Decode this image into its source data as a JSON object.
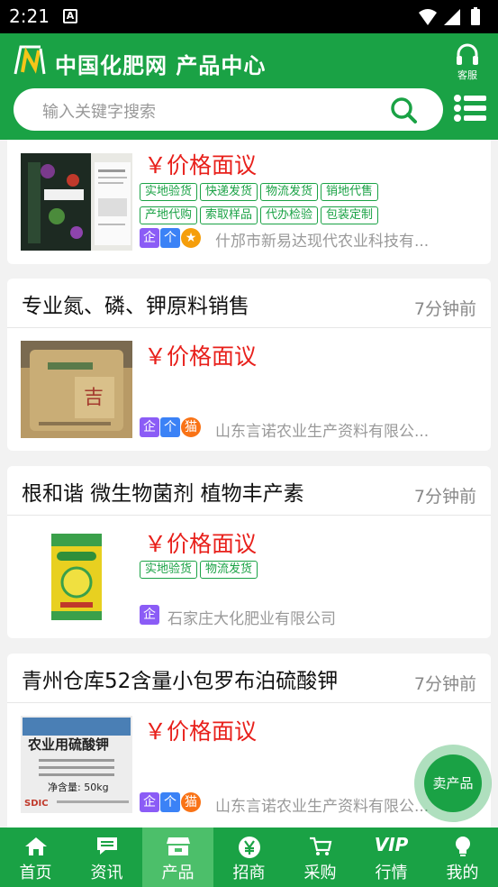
{
  "status_bar": {
    "time": "2:21",
    "notification_letter": "A"
  },
  "header": {
    "logo_letter": "N",
    "title": "中国化肥网 产品中心",
    "service_label": "客服",
    "search_placeholder": "输入关键字搜索"
  },
  "products": [
    {
      "title": "",
      "time": "",
      "price": "￥价格面议",
      "tags": [
        "实地验货",
        "快递发货",
        "物流发货",
        "销地代售",
        "产地代购",
        "索取样品",
        "代办检验",
        "包装定制"
      ],
      "badges": [
        "企",
        "个",
        "★"
      ],
      "company": "什邡市新易达现代农业科技有...",
      "thumb_text": "NUTRITION"
    },
    {
      "title": "专业氮、磷、钾原料销售",
      "time": "7分钟前",
      "price": "￥价格面议",
      "tags": [],
      "badges": [
        "企",
        "个",
        "猫"
      ],
      "company": "山东言诺农业生产资料有限公..."
    },
    {
      "title": "根和谐 微生物菌剂   植物丰产素",
      "time": "7分钟前",
      "price": "￥价格面议",
      "tags": [
        "实地验货",
        "物流发货"
      ],
      "badges": [
        "企"
      ],
      "company": "石家庄大化肥业有限公司"
    },
    {
      "title": "青州仓库52含量小包罗布泊硫酸钾",
      "time": "7分钟前",
      "price": "￥价格面议",
      "tags": [],
      "badges": [
        "企",
        "个",
        "猫"
      ],
      "company": "山东言诺农业生产资料有限公...",
      "thumb_title": "农业用硫酸钾",
      "thumb_weight": "净含量: 50kg",
      "thumb_brand": "SDIC"
    }
  ],
  "float_button": {
    "label": "卖产品"
  },
  "bottom_nav": [
    {
      "label": "首页",
      "icon": "home-icon"
    },
    {
      "label": "资讯",
      "icon": "chat-icon"
    },
    {
      "label": "产品",
      "icon": "store-icon",
      "active": true
    },
    {
      "label": "招商",
      "icon": "yen-icon"
    },
    {
      "label": "采购",
      "icon": "cart-icon"
    },
    {
      "label": "行情",
      "icon": "vip-icon",
      "icon_text": "VIP"
    },
    {
      "label": "我的",
      "icon": "bulb-icon"
    }
  ],
  "colors": {
    "brand_green": "#1aa245",
    "price_red": "#e8201b",
    "active_tab": "#4cbf6a"
  }
}
